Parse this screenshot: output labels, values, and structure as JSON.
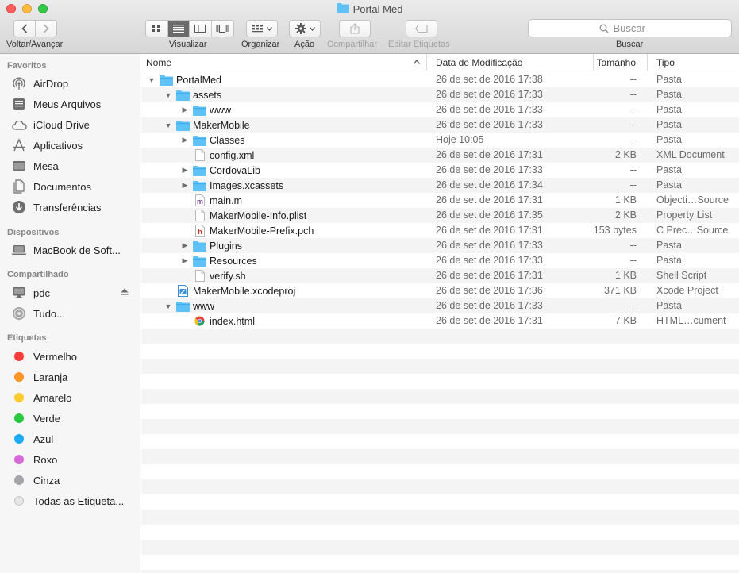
{
  "window": {
    "title": "Portal Med"
  },
  "toolbar": {
    "nav_label": "Voltar/Avançar",
    "view_label": "Visualizar",
    "arrange_label": "Organizar",
    "action_label": "Ação",
    "share_label": "Compartilhar",
    "tags_label": "Editar Etiquetas",
    "search_label": "Buscar",
    "search_placeholder": "Buscar"
  },
  "sidebar": {
    "sections": {
      "favorites": "Favoritos",
      "devices": "Dispositivos",
      "shared": "Compartilhado",
      "tags": "Etiquetas"
    },
    "favorites": [
      {
        "label": "AirDrop",
        "icon": "airdrop-icon"
      },
      {
        "label": "Meus Arquivos",
        "icon": "all-files-icon"
      },
      {
        "label": "iCloud Drive",
        "icon": "cloud-icon"
      },
      {
        "label": "Aplicativos",
        "icon": "applications-icon"
      },
      {
        "label": "Mesa",
        "icon": "desktop-icon"
      },
      {
        "label": "Documentos",
        "icon": "documents-icon"
      },
      {
        "label": "Transferências",
        "icon": "downloads-icon"
      }
    ],
    "devices": [
      {
        "label": "MacBook de Soft...",
        "icon": "laptop-icon"
      }
    ],
    "shared": [
      {
        "label": "pdc",
        "icon": "server-icon"
      },
      {
        "label": "Tudo...",
        "icon": "network-icon"
      }
    ],
    "tags": [
      {
        "label": "Vermelho",
        "color": "#fc3d39"
      },
      {
        "label": "Laranja",
        "color": "#fd9426"
      },
      {
        "label": "Amarelo",
        "color": "#fecb2f"
      },
      {
        "label": "Verde",
        "color": "#29c940"
      },
      {
        "label": "Azul",
        "color": "#1badf8"
      },
      {
        "label": "Roxo",
        "color": "#d869d8"
      },
      {
        "label": "Cinza",
        "color": "#a4a4a8"
      },
      {
        "label": "Todas as Etiqueta...",
        "color": "#dcdcdc"
      }
    ]
  },
  "columns": {
    "name": "Nome",
    "date": "Data de Modificação",
    "size": "Tamanho",
    "kind": "Tipo"
  },
  "files": [
    {
      "name": "PortalMed",
      "date": "26 de set de 2016 17:38",
      "size": "--",
      "kind": "Pasta",
      "depth": 0,
      "disclosure": "open",
      "type": "folder"
    },
    {
      "name": "assets",
      "date": "26 de set de 2016 17:33",
      "size": "--",
      "kind": "Pasta",
      "depth": 1,
      "disclosure": "open",
      "type": "folder"
    },
    {
      "name": "www",
      "date": "26 de set de 2016 17:33",
      "size": "--",
      "kind": "Pasta",
      "depth": 2,
      "disclosure": "closed",
      "type": "folder"
    },
    {
      "name": "MakerMobile",
      "date": "26 de set de 2016 17:33",
      "size": "--",
      "kind": "Pasta",
      "depth": 1,
      "disclosure": "open",
      "type": "folder"
    },
    {
      "name": "Classes",
      "date": "Hoje 10:05",
      "size": "--",
      "kind": "Pasta",
      "depth": 2,
      "disclosure": "closed",
      "type": "folder"
    },
    {
      "name": "config.xml",
      "date": "26 de set de 2016 17:31",
      "size": "2 KB",
      "kind": "XML Document",
      "depth": 2,
      "disclosure": "none",
      "type": "doc"
    },
    {
      "name": "CordovaLib",
      "date": "26 de set de 2016 17:33",
      "size": "--",
      "kind": "Pasta",
      "depth": 2,
      "disclosure": "closed",
      "type": "folder"
    },
    {
      "name": "Images.xcassets",
      "date": "26 de set de 2016 17:34",
      "size": "--",
      "kind": "Pasta",
      "depth": 2,
      "disclosure": "closed",
      "type": "folder"
    },
    {
      "name": "main.m",
      "date": "26 de set de 2016 17:31",
      "size": "1 KB",
      "kind": "Objecti…Source",
      "depth": 2,
      "disclosure": "none",
      "type": "m"
    },
    {
      "name": "MakerMobile-Info.plist",
      "date": "26 de set de 2016 17:35",
      "size": "2 KB",
      "kind": "Property List",
      "depth": 2,
      "disclosure": "none",
      "type": "doc"
    },
    {
      "name": "MakerMobile-Prefix.pch",
      "date": "26 de set de 2016 17:31",
      "size": "153 bytes",
      "kind": "C Prec…Source",
      "depth": 2,
      "disclosure": "none",
      "type": "h"
    },
    {
      "name": "Plugins",
      "date": "26 de set de 2016 17:33",
      "size": "--",
      "kind": "Pasta",
      "depth": 2,
      "disclosure": "closed",
      "type": "folder"
    },
    {
      "name": "Resources",
      "date": "26 de set de 2016 17:33",
      "size": "--",
      "kind": "Pasta",
      "depth": 2,
      "disclosure": "closed",
      "type": "folder"
    },
    {
      "name": "verify.sh",
      "date": "26 de set de 2016 17:31",
      "size": "1 KB",
      "kind": "Shell Script",
      "depth": 2,
      "disclosure": "none",
      "type": "doc"
    },
    {
      "name": "MakerMobile.xcodeproj",
      "date": "26 de set de 2016 17:36",
      "size": "371 KB",
      "kind": "Xcode Project",
      "depth": 1,
      "disclosure": "none",
      "type": "xcode"
    },
    {
      "name": "www",
      "date": "26 de set de 2016 17:33",
      "size": "--",
      "kind": "Pasta",
      "depth": 1,
      "disclosure": "open",
      "type": "folder"
    },
    {
      "name": "index.html",
      "date": "26 de set de 2016 17:31",
      "size": "7 KB",
      "kind": "HTML…cument",
      "depth": 2,
      "disclosure": "none",
      "type": "html"
    }
  ],
  "colors": {
    "folder": "#5ec2f7",
    "folder_dark": "#3aa9e6",
    "selection": "#6b6b6b"
  }
}
